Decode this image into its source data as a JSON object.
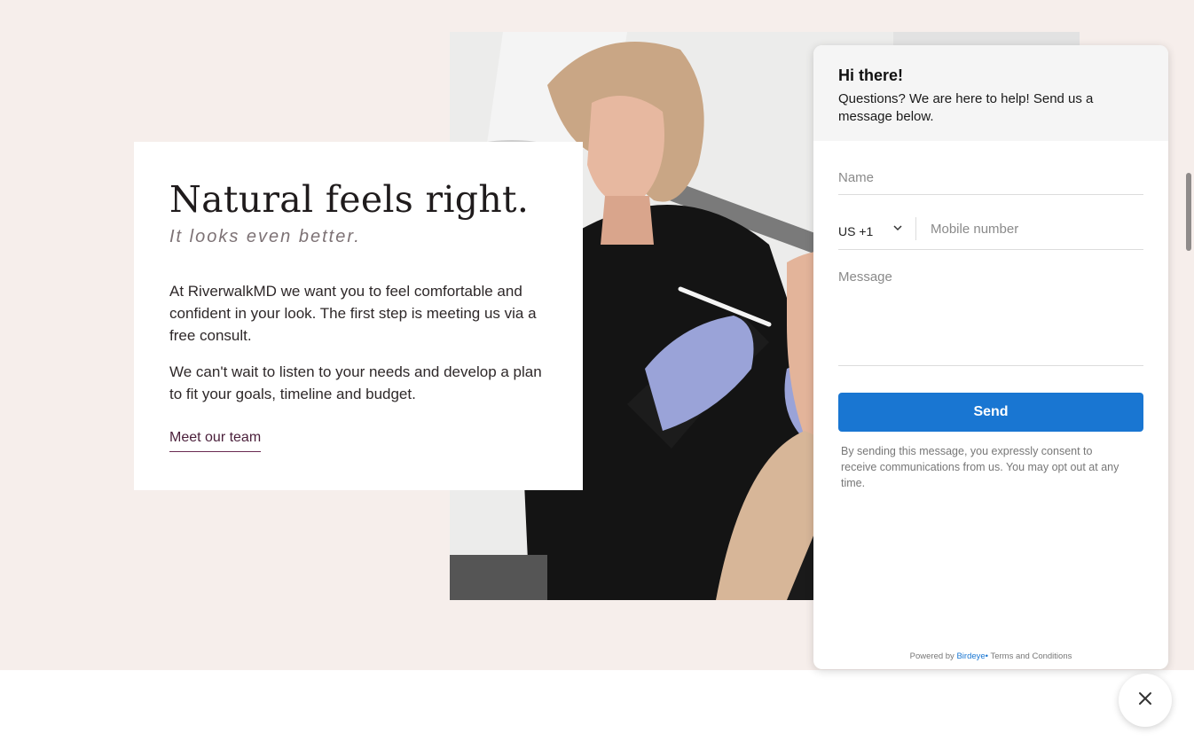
{
  "hero": {
    "title": "Natural feels right.",
    "subtitle": "It looks even better.",
    "paragraph1": "At RiverwalkMD we want you to feel comfortable and confident in your look. The first step is meeting us via a free consult.",
    "paragraph2": "We can't wait to listen to your needs and develop a plan to fit your goals, timeline and budget.",
    "link_label": "Meet our team"
  },
  "widget": {
    "greeting": "Hi there!",
    "subtext": "Questions? We are here to help! Send us a message below.",
    "name_placeholder": "Name",
    "country_code": "US +1",
    "phone_placeholder": "Mobile number",
    "message_placeholder": "Message",
    "send_label": "Send",
    "consent": "By sending this message, you expressly consent to receive communications from us. You may opt out at any time.",
    "powered_by": "Powered by",
    "brand": "Birdeye",
    "terms": "Terms and Conditions"
  },
  "icons": {
    "chevron": "chevron-down-icon",
    "close": "close-icon"
  },
  "colors": {
    "page_bg": "#f6eeeb",
    "accent": "#1976d2",
    "link_underline": "#6a2a52"
  }
}
